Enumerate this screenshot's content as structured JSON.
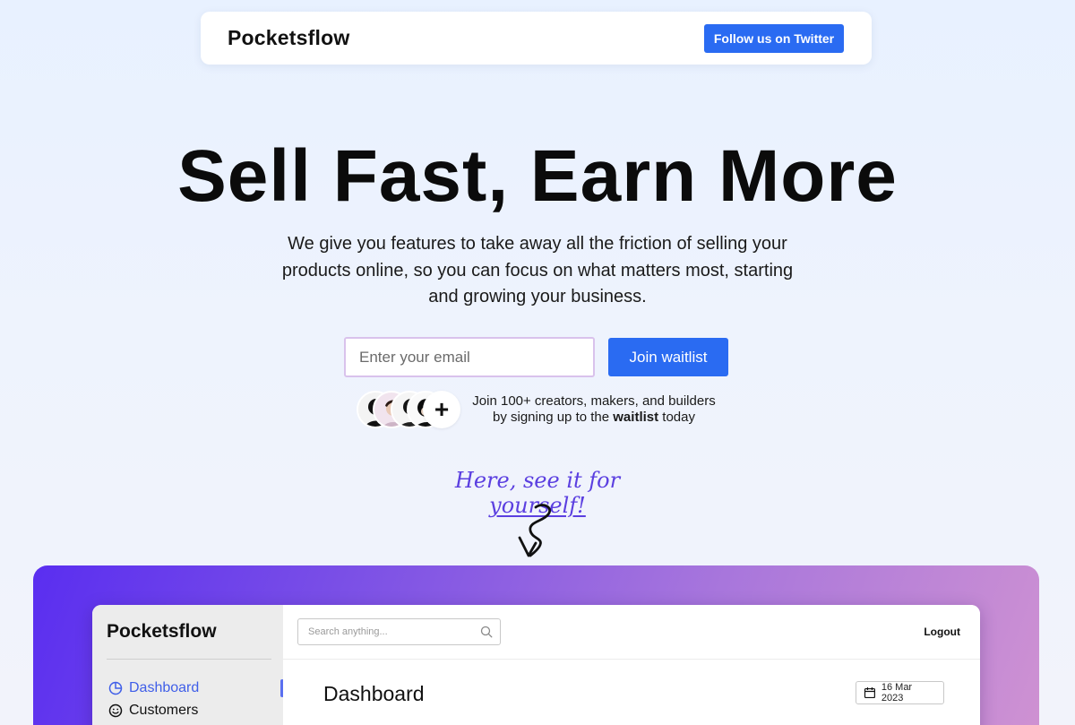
{
  "nav": {
    "logo": "Pocketsflow",
    "twitter_button": "Follow us on Twitter"
  },
  "hero": {
    "title": "Sell Fast, Earn More",
    "subtitle": "We give you features to take away all the friction of selling your products online, so you can focus on what matters most, starting and growing your business."
  },
  "waitlist": {
    "email_placeholder": "Enter your email",
    "join_button": "Join waitlist",
    "avatar_plus": "+",
    "social_text_1": "Join 100+ creators, makers, and builders",
    "social_text_2a": "by signing up to the ",
    "social_text_2b": "waitlist",
    "social_text_2c": " today"
  },
  "callout": {
    "text_a": "Here, see it for ",
    "text_b": "yourself!"
  },
  "app_preview": {
    "logo": "Pocketsflow",
    "sidebar": [
      {
        "label": "Dashboard",
        "icon": "pie-chart-icon",
        "active": true
      },
      {
        "label": "Customers",
        "icon": "smiley-icon",
        "active": false
      }
    ],
    "search_placeholder": "Search anything...",
    "logout": "Logout",
    "page_title": "Dashboard",
    "date": "16 Mar 2023"
  },
  "colors": {
    "accent": "#2a6bf2",
    "handwritten": "#5b3fe0",
    "sidebar_active": "#3f5ee8"
  }
}
